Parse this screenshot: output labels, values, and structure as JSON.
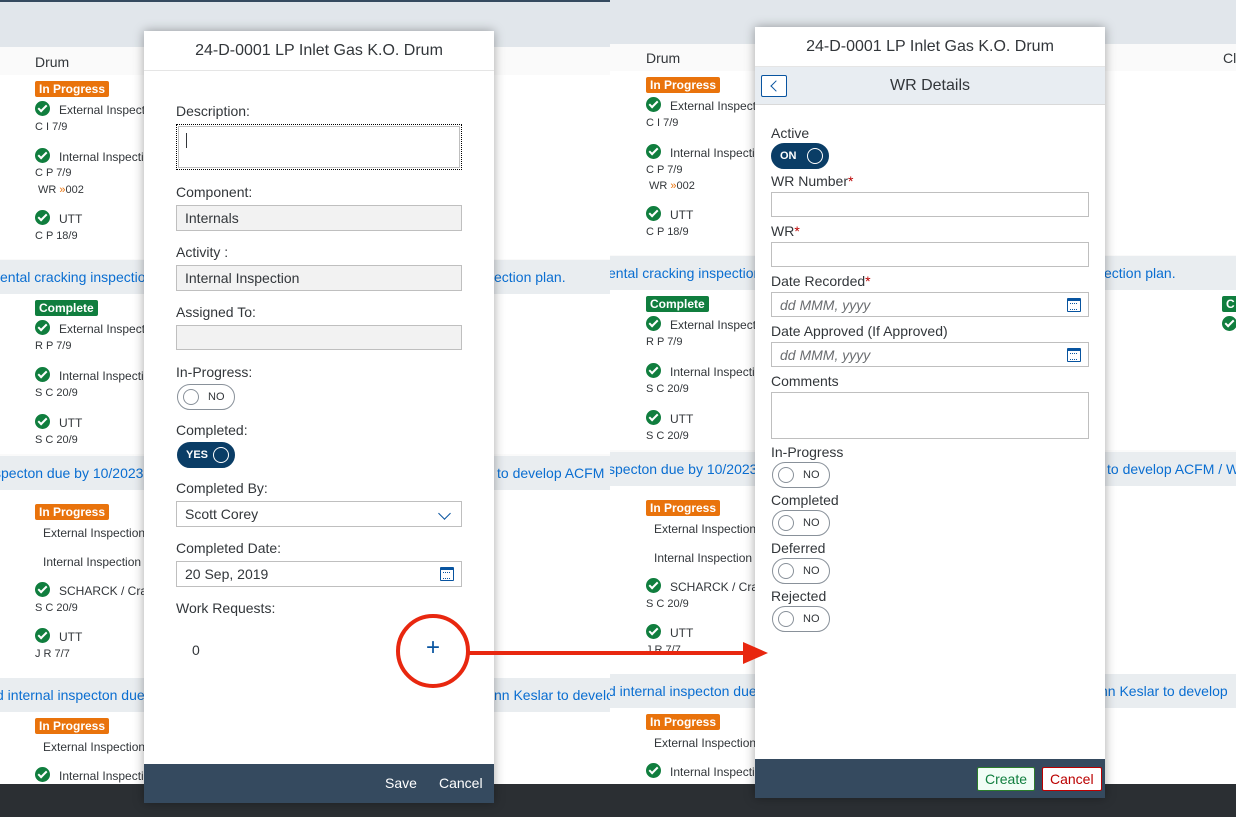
{
  "background_left": {
    "column_header": "Drum",
    "rows": [
      {
        "badge": "In Progress",
        "kind": "prog"
      },
      {
        "label": "External Inspection",
        "meta": "C I   7/9"
      },
      {
        "label": "Internal Inspection",
        "meta": "C P   7/9",
        "wr": "WR",
        "wr_num": "002"
      },
      {
        "label": "UTT",
        "meta": "C P   18/9"
      }
    ],
    "band1_left": "ental cracking inspection",
    "band1_right": "ection plan.",
    "rows2": [
      {
        "badge": "Complete"
      },
      {
        "label": "External Inspection",
        "meta": "R P   7/9"
      },
      {
        "label": "Internal Inspection",
        "meta": "S C   20/9"
      },
      {
        "label": "UTT",
        "meta": "S C   20/9"
      }
    ],
    "band2_left": "specton due by 10/2023.",
    "band2_right": "to develop ACFM",
    "rows3": [
      {
        "badge": "In Progress"
      },
      {
        "label": "External Inspection"
      },
      {
        "label": "Internal Inspection"
      },
      {
        "label": "SCHARCK / Crac",
        "meta": "S C   20/9"
      },
      {
        "label": "UTT",
        "meta": "J R   7/7"
      }
    ],
    "band3_left": "d internal inspecton due",
    "band3_right": "nn Keslar to develo",
    "rows4": [
      {
        "badge": "In Progress"
      },
      {
        "label": "External Inspection"
      },
      {
        "label": "Internal Inspection"
      }
    ]
  },
  "background_right": {
    "column_header": "Drum",
    "column_header_2": "Cl",
    "band1_left": "ental cracking inspection",
    "band1_right": "ection plan.",
    "band2_left": "specton due by 10/2023.",
    "band2_right": "to develop ACFM / W",
    "band3_left": "d internal inspecton due",
    "band3_right": "nn Keslar to develop"
  },
  "dialog1": {
    "title": "24-D-0001 LP Inlet Gas K.O. Drum",
    "description_label": "Description:",
    "description_value": "",
    "component_label": "Component:",
    "component_value": "Internals",
    "activity_label": "Activity :",
    "activity_value": "Internal Inspection",
    "assigned_label": "Assigned To:",
    "assigned_value": "",
    "inprogress_label": "In-Progress:",
    "inprogress_toggle": "NO",
    "completed_label": "Completed:",
    "completed_toggle": "YES",
    "completed_by_label": "Completed By:",
    "completed_by_value": "Scott Corey",
    "completed_date_label": "Completed Date:",
    "completed_date_value": "20 Sep, 2019",
    "work_requests_label": "Work Requests:",
    "work_requests_count": "0",
    "add_symbol": "+",
    "save": "Save",
    "cancel": "Cancel"
  },
  "dialog2": {
    "title": "24-D-0001 LP Inlet Gas K.O. Drum",
    "subtitle": "WR Details",
    "active_label": "Active",
    "active_toggle": "ON",
    "wr_number_label": "WR Number",
    "wr_label": "WR",
    "required_mark": "*",
    "date_recorded_label": "Date Recorded",
    "date_placeholder": "dd MMM, yyyy",
    "date_approved_label": "Date Approved (If Approved)",
    "comments_label": "Comments",
    "inprogress_label": "In-Progress",
    "completed_label": "Completed",
    "deferred_label": "Deferred",
    "rejected_label": "Rejected",
    "toggle_no": "NO",
    "create": "Create",
    "cancel": "Cancel"
  },
  "colors": {
    "accent": "#0a6ed1",
    "shell": "#354a5f",
    "arrow": "#e8270f",
    "in_progress": "#e9730c",
    "complete": "#107e3e"
  }
}
